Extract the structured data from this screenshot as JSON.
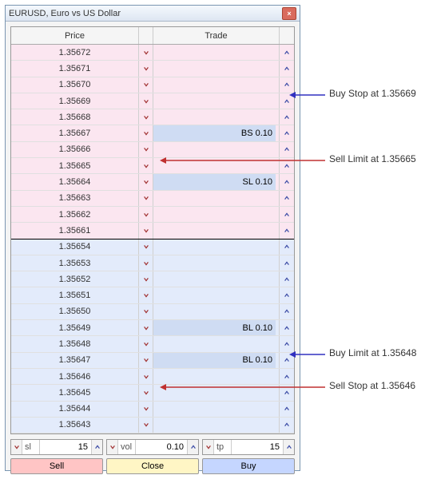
{
  "window": {
    "title": "EURUSD, Euro vs US Dollar",
    "close_glyph": "×"
  },
  "headers": {
    "price": "Price",
    "trade": "Trade"
  },
  "ask_rows": [
    {
      "price": "1.35672",
      "trade": ""
    },
    {
      "price": "1.35671",
      "trade": ""
    },
    {
      "price": "1.35670",
      "trade": ""
    },
    {
      "price": "1.35669",
      "trade": ""
    },
    {
      "price": "1.35668",
      "trade": ""
    },
    {
      "price": "1.35667",
      "trade": "BS 0.10"
    },
    {
      "price": "1.35666",
      "trade": ""
    },
    {
      "price": "1.35665",
      "trade": ""
    },
    {
      "price": "1.35664",
      "trade": "SL 0.10"
    },
    {
      "price": "1.35663",
      "trade": ""
    },
    {
      "price": "1.35662",
      "trade": ""
    },
    {
      "price": "1.35661",
      "trade": ""
    }
  ],
  "bid_rows": [
    {
      "price": "1.35654",
      "trade": ""
    },
    {
      "price": "1.35653",
      "trade": ""
    },
    {
      "price": "1.35652",
      "trade": ""
    },
    {
      "price": "1.35651",
      "trade": ""
    },
    {
      "price": "1.35650",
      "trade": ""
    },
    {
      "price": "1.35649",
      "trade": "BL 0.10"
    },
    {
      "price": "1.35648",
      "trade": ""
    },
    {
      "price": "1.35647",
      "trade": "BL 0.10"
    },
    {
      "price": "1.35646",
      "trade": ""
    },
    {
      "price": "1.35645",
      "trade": ""
    },
    {
      "price": "1.35644",
      "trade": ""
    },
    {
      "price": "1.35643",
      "trade": ""
    }
  ],
  "footer": {
    "sl": {
      "label": "sl",
      "value": "15"
    },
    "vol": {
      "label": "vol",
      "value": "0.10"
    },
    "tp": {
      "label": "tp",
      "value": "15"
    },
    "sell": "Sell",
    "close": "Close",
    "buy": "Buy"
  },
  "annotations": {
    "buy_stop": "Buy Stop at 1.35669",
    "sell_limit": "Sell Limit at 1.35665",
    "buy_limit": "Buy Limit at 1.35648",
    "sell_stop": "Sell Stop at 1.35646"
  }
}
